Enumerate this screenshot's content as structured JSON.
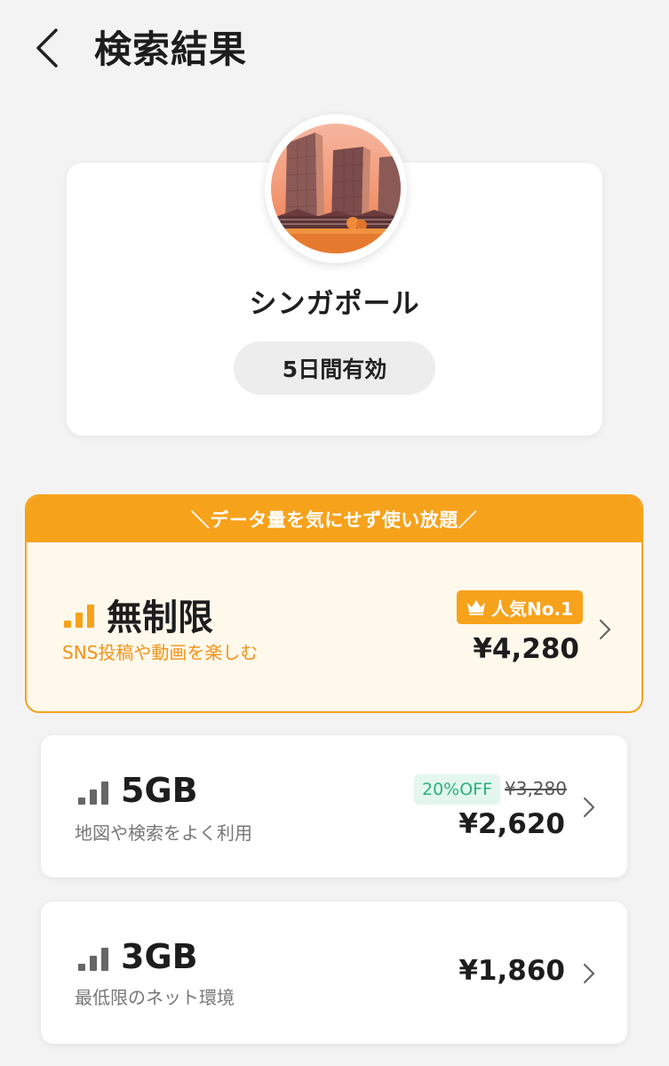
{
  "header": {
    "title": "検索結果"
  },
  "destination": {
    "name": "シンガポール",
    "validity": "5日間有効"
  },
  "featured_plan": {
    "banner": "＼データ量を気にせず使い放題／",
    "name": "無制限",
    "description": "SNS投稿や動画を楽しむ",
    "badge": "人気No.1",
    "price": "¥4,280"
  },
  "plans": [
    {
      "name": "5GB",
      "description": "地図や検索をよく利用",
      "discount": "20%OFF",
      "original_price": "¥3,280",
      "price": "¥2,620"
    },
    {
      "name": "3GB",
      "description": "最低限のネット環境",
      "price": "¥1,860"
    }
  ],
  "colors": {
    "accent": "#f7a21b",
    "featured_bg": "#fff9ec",
    "discount_text": "#2bb27a",
    "discount_bg": "#e3f7ee",
    "page_bg": "#f3f3f3"
  }
}
